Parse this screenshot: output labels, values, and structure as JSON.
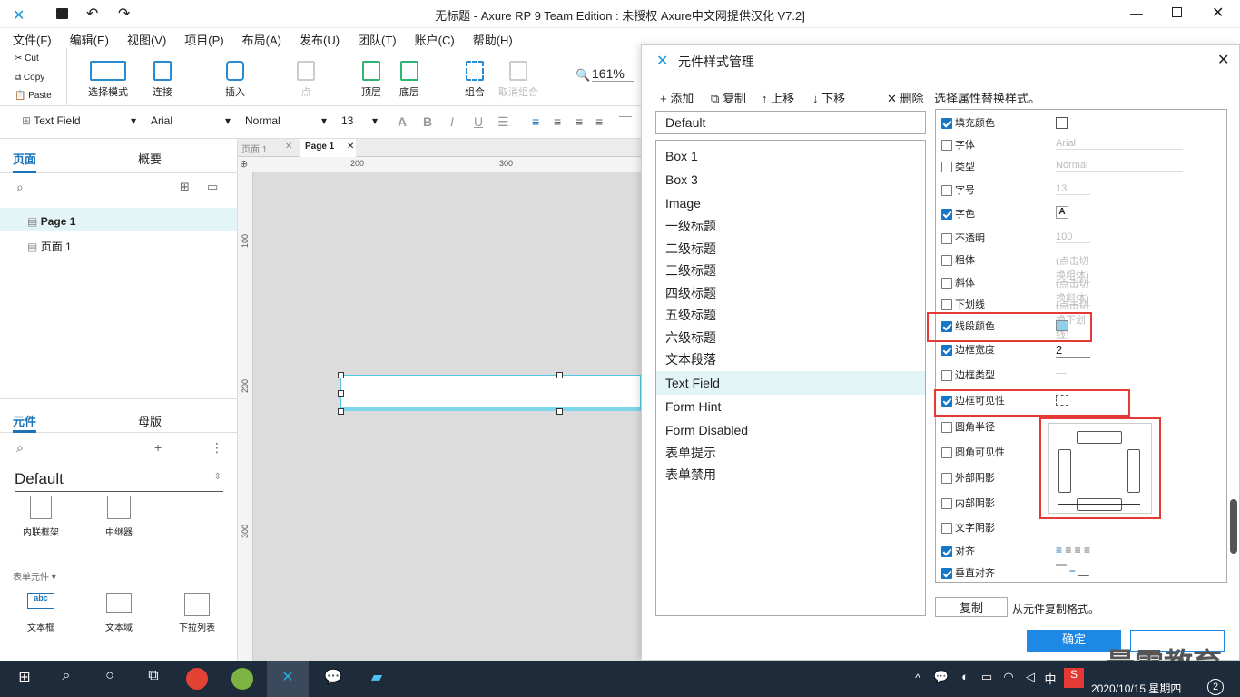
{
  "window": {
    "title": "无标题 - Axure RP 9 Team Edition : 未授权    Axure中文网提供汉化 V7.2]"
  },
  "menu": [
    "文件(F)",
    "编辑(E)",
    "视图(V)",
    "项目(P)",
    "布局(A)",
    "发布(U)",
    "团队(T)",
    "账户(C)",
    "帮助(H)"
  ],
  "clipboard": [
    "Cut",
    "Copy",
    "Paste"
  ],
  "toolbar": {
    "select_mode": "选择模式",
    "connect": "连接",
    "insert": "插入",
    "point": "点",
    "top": "顶层",
    "bottom": "底层",
    "group": "组合",
    "ungroup": "取消组合",
    "zoom": "161%"
  },
  "format": {
    "style": "Text Field",
    "font": "Arial",
    "weight": "Normal",
    "size": "13"
  },
  "pages_panel": {
    "tab_pages": "页面",
    "tab_outline": "概要",
    "items": [
      "Page 1",
      "页面 1"
    ]
  },
  "widgets_panel": {
    "tab_widgets": "元件",
    "tab_masters": "母版",
    "library": "Default",
    "items": [
      "内联框架",
      "中继器"
    ],
    "section": "表单元件 ▾",
    "form_items": [
      "文本框",
      "文本域",
      "下拉列表"
    ]
  },
  "canvas": {
    "tabs": [
      "页面 1",
      "Page 1"
    ],
    "ruler_h": [
      "200",
      "300"
    ],
    "ruler_v": [
      "100",
      "200",
      "300"
    ]
  },
  "dialog": {
    "title": "元件样式管理",
    "add": "添加",
    "copy": "复制",
    "up": "上移",
    "down": "下移",
    "delete": "删除",
    "hint": "选择属性替换样式。",
    "default_style": "Default",
    "styles": [
      "Box 1",
      "Box 3",
      "Image",
      "一级标题",
      "二级标题",
      "三级标题",
      "四级标题",
      "五级标题",
      "六级标题",
      "文本段落",
      "Text Field",
      "Form Hint",
      "Form Disabled",
      "表单提示",
      "表单禁用"
    ],
    "props": [
      {
        "label": "填充颜色",
        "on": true
      },
      {
        "label": "字体",
        "on": false,
        "value": "Arial"
      },
      {
        "label": "类型",
        "on": false,
        "value": "Normal"
      },
      {
        "label": "字号",
        "on": false,
        "value": "13"
      },
      {
        "label": "字色",
        "on": true
      },
      {
        "label": "不透明",
        "on": false,
        "value": "100"
      },
      {
        "label": "粗体",
        "on": false,
        "value": "(点击切换粗体)"
      },
      {
        "label": "斜体",
        "on": false,
        "value": "(点击切换斜体)"
      },
      {
        "label": "下划线",
        "on": false,
        "value": "(点击切换下划线)"
      },
      {
        "label": "线段颜色",
        "on": true
      },
      {
        "label": "边框宽度",
        "on": true,
        "value": "2"
      },
      {
        "label": "边框类型",
        "on": false
      },
      {
        "label": "边框可见性",
        "on": true
      },
      {
        "label": "圆角半径",
        "on": false
      },
      {
        "label": "圆角可见性",
        "on": false
      },
      {
        "label": "外部阴影",
        "on": false
      },
      {
        "label": "内部阴影",
        "on": false
      },
      {
        "label": "文字阴影",
        "on": false
      },
      {
        "label": "对齐",
        "on": true
      },
      {
        "label": "垂直对齐",
        "on": true
      }
    ],
    "copy_btn": "复制",
    "copy_from": "从元件复制格式。",
    "ok": "确定"
  },
  "watermark": "最需教育",
  "taskbar": {
    "ime": "中",
    "date": "2020/10/15 星期四",
    "badge": "2"
  }
}
